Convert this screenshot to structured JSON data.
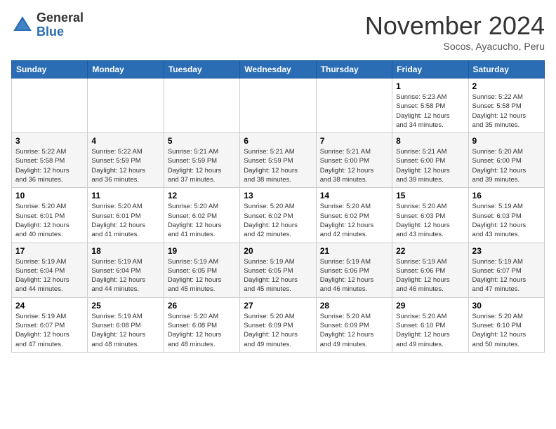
{
  "header": {
    "logo_general": "General",
    "logo_blue": "Blue",
    "month_title": "November 2024",
    "subtitle": "Socos, Ayacucho, Peru"
  },
  "days_of_week": [
    "Sunday",
    "Monday",
    "Tuesday",
    "Wednesday",
    "Thursday",
    "Friday",
    "Saturday"
  ],
  "weeks": [
    [
      {
        "day": null,
        "info": null
      },
      {
        "day": null,
        "info": null
      },
      {
        "day": null,
        "info": null
      },
      {
        "day": null,
        "info": null
      },
      {
        "day": null,
        "info": null
      },
      {
        "day": "1",
        "info": "Sunrise: 5:23 AM\nSunset: 5:58 PM\nDaylight: 12 hours\nand 34 minutes."
      },
      {
        "day": "2",
        "info": "Sunrise: 5:22 AM\nSunset: 5:58 PM\nDaylight: 12 hours\nand 35 minutes."
      }
    ],
    [
      {
        "day": "3",
        "info": "Sunrise: 5:22 AM\nSunset: 5:58 PM\nDaylight: 12 hours\nand 36 minutes."
      },
      {
        "day": "4",
        "info": "Sunrise: 5:22 AM\nSunset: 5:59 PM\nDaylight: 12 hours\nand 36 minutes."
      },
      {
        "day": "5",
        "info": "Sunrise: 5:21 AM\nSunset: 5:59 PM\nDaylight: 12 hours\nand 37 minutes."
      },
      {
        "day": "6",
        "info": "Sunrise: 5:21 AM\nSunset: 5:59 PM\nDaylight: 12 hours\nand 38 minutes."
      },
      {
        "day": "7",
        "info": "Sunrise: 5:21 AM\nSunset: 6:00 PM\nDaylight: 12 hours\nand 38 minutes."
      },
      {
        "day": "8",
        "info": "Sunrise: 5:21 AM\nSunset: 6:00 PM\nDaylight: 12 hours\nand 39 minutes."
      },
      {
        "day": "9",
        "info": "Sunrise: 5:20 AM\nSunset: 6:00 PM\nDaylight: 12 hours\nand 39 minutes."
      }
    ],
    [
      {
        "day": "10",
        "info": "Sunrise: 5:20 AM\nSunset: 6:01 PM\nDaylight: 12 hours\nand 40 minutes."
      },
      {
        "day": "11",
        "info": "Sunrise: 5:20 AM\nSunset: 6:01 PM\nDaylight: 12 hours\nand 41 minutes."
      },
      {
        "day": "12",
        "info": "Sunrise: 5:20 AM\nSunset: 6:02 PM\nDaylight: 12 hours\nand 41 minutes."
      },
      {
        "day": "13",
        "info": "Sunrise: 5:20 AM\nSunset: 6:02 PM\nDaylight: 12 hours\nand 42 minutes."
      },
      {
        "day": "14",
        "info": "Sunrise: 5:20 AM\nSunset: 6:02 PM\nDaylight: 12 hours\nand 42 minutes."
      },
      {
        "day": "15",
        "info": "Sunrise: 5:20 AM\nSunset: 6:03 PM\nDaylight: 12 hours\nand 43 minutes."
      },
      {
        "day": "16",
        "info": "Sunrise: 5:19 AM\nSunset: 6:03 PM\nDaylight: 12 hours\nand 43 minutes."
      }
    ],
    [
      {
        "day": "17",
        "info": "Sunrise: 5:19 AM\nSunset: 6:04 PM\nDaylight: 12 hours\nand 44 minutes."
      },
      {
        "day": "18",
        "info": "Sunrise: 5:19 AM\nSunset: 6:04 PM\nDaylight: 12 hours\nand 44 minutes."
      },
      {
        "day": "19",
        "info": "Sunrise: 5:19 AM\nSunset: 6:05 PM\nDaylight: 12 hours\nand 45 minutes."
      },
      {
        "day": "20",
        "info": "Sunrise: 5:19 AM\nSunset: 6:05 PM\nDaylight: 12 hours\nand 45 minutes."
      },
      {
        "day": "21",
        "info": "Sunrise: 5:19 AM\nSunset: 6:06 PM\nDaylight: 12 hours\nand 46 minutes."
      },
      {
        "day": "22",
        "info": "Sunrise: 5:19 AM\nSunset: 6:06 PM\nDaylight: 12 hours\nand 46 minutes."
      },
      {
        "day": "23",
        "info": "Sunrise: 5:19 AM\nSunset: 6:07 PM\nDaylight: 12 hours\nand 47 minutes."
      }
    ],
    [
      {
        "day": "24",
        "info": "Sunrise: 5:19 AM\nSunset: 6:07 PM\nDaylight: 12 hours\nand 47 minutes."
      },
      {
        "day": "25",
        "info": "Sunrise: 5:19 AM\nSunset: 6:08 PM\nDaylight: 12 hours\nand 48 minutes."
      },
      {
        "day": "26",
        "info": "Sunrise: 5:20 AM\nSunset: 6:08 PM\nDaylight: 12 hours\nand 48 minutes."
      },
      {
        "day": "27",
        "info": "Sunrise: 5:20 AM\nSunset: 6:09 PM\nDaylight: 12 hours\nand 49 minutes."
      },
      {
        "day": "28",
        "info": "Sunrise: 5:20 AM\nSunset: 6:09 PM\nDaylight: 12 hours\nand 49 minutes."
      },
      {
        "day": "29",
        "info": "Sunrise: 5:20 AM\nSunset: 6:10 PM\nDaylight: 12 hours\nand 49 minutes."
      },
      {
        "day": "30",
        "info": "Sunrise: 5:20 AM\nSunset: 6:10 PM\nDaylight: 12 hours\nand 50 minutes."
      }
    ]
  ]
}
